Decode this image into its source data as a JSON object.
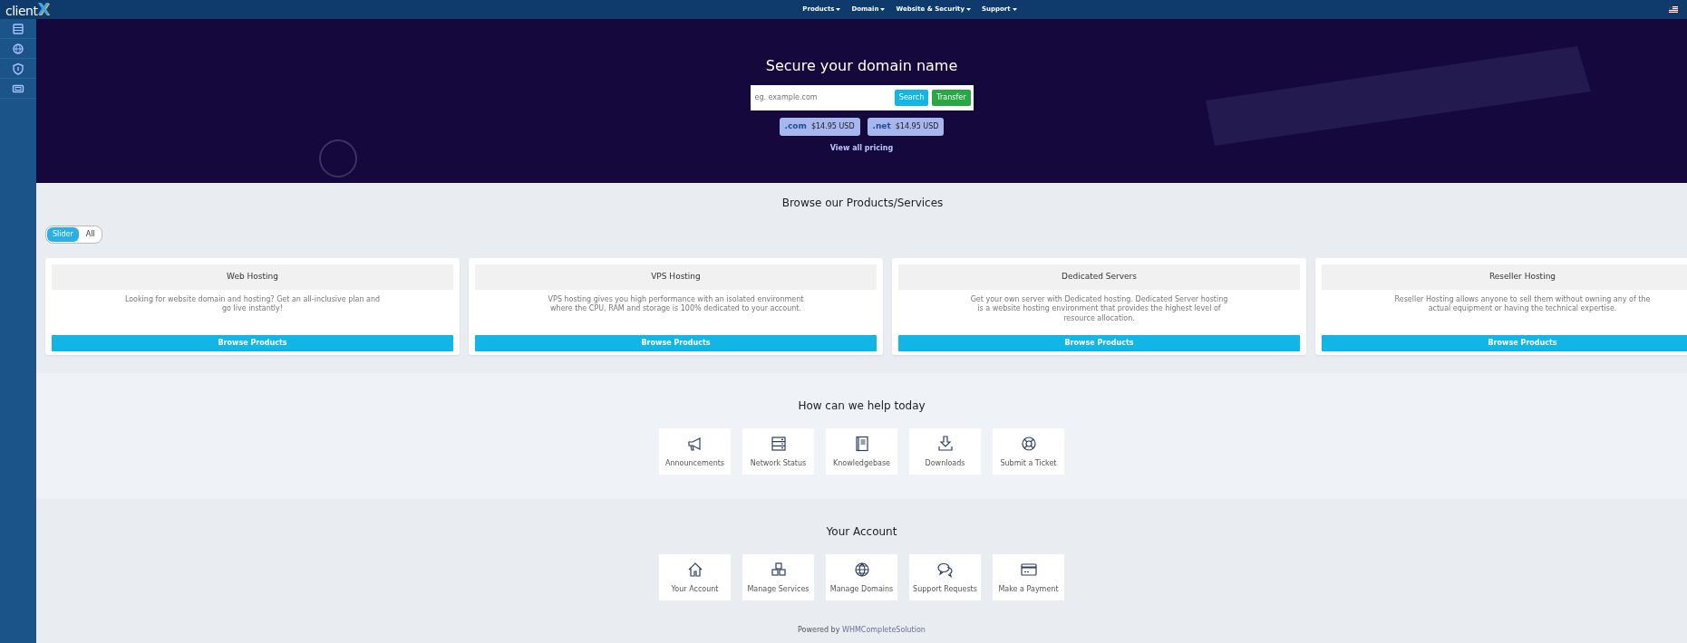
{
  "logo": {
    "text": "client",
    "mark": "X"
  },
  "nav": [
    {
      "label": "Products"
    },
    {
      "label": "Domain"
    },
    {
      "label": "Website & Security"
    },
    {
      "label": "Support"
    }
  ],
  "sidebar": {
    "items": [
      {
        "kind": "server"
      },
      {
        "kind": "globe"
      },
      {
        "kind": "shield"
      },
      {
        "kind": "ticket"
      }
    ]
  },
  "hero": {
    "title": "Secure your domain name",
    "search": {
      "placeholder": "eg. example.com"
    },
    "buttons": [
      {
        "label": "Search",
        "kind": "search"
      },
      {
        "label": "Transfer",
        "kind": "transfer"
      }
    ],
    "tlds": [
      {
        "tld": ".com",
        "price": "$14.95 USD"
      },
      {
        "tld": ".net",
        "price": "$14.95 USD"
      }
    ],
    "link": "View all pricing"
  },
  "products": {
    "title": "Browse our Products/Services",
    "toggle": [
      {
        "label": "Slider",
        "selected": true
      },
      {
        "label": "All",
        "selected": false
      }
    ],
    "cards": [
      {
        "title": "Web Hosting",
        "text": "Looking for website domain and hosting? Get an all-inclusive plan and go live instantly!",
        "button": "Browse Products"
      },
      {
        "title": "VPS Hosting",
        "text": "VPS hosting gives you high performance with an isolated environment where the CPU, RAM and storage is 100% dedicated to your account.",
        "button": "Browse Products"
      },
      {
        "title": "Dedicated Servers",
        "text": "Get your own server with Dedicated hosting. Dedicated Server hosting is a website hosting environment that provides the highest level of resource allocation.",
        "button": "Browse Products"
      },
      {
        "title": "Reseller Hosting",
        "text": "Reseller Hosting allows anyone to sell them without owning any of the actual equipment or having the technical expertise.",
        "button": "Browse Products"
      }
    ]
  },
  "help": {
    "title": "How can we help today",
    "tiles": [
      {
        "label": "Announcements",
        "kind": "megaphone"
      },
      {
        "label": "Network Status",
        "kind": "server"
      },
      {
        "label": "Knowledgebase",
        "kind": "book"
      },
      {
        "label": "Downloads",
        "kind": "download"
      },
      {
        "label": "Submit a Ticket",
        "kind": "lifebuoy"
      }
    ]
  },
  "account": {
    "title": "Your Account",
    "tiles": [
      {
        "label": "Your Account",
        "kind": "house"
      },
      {
        "label": "Manage Services",
        "kind": "boxes"
      },
      {
        "label": "Manage Domains",
        "kind": "globe"
      },
      {
        "label": "Support Requests",
        "kind": "chat"
      },
      {
        "label": "Make a Payment",
        "kind": "card"
      }
    ]
  },
  "footer": {
    "text": "Powered by",
    "link": "WHMCompleteSolution"
  }
}
